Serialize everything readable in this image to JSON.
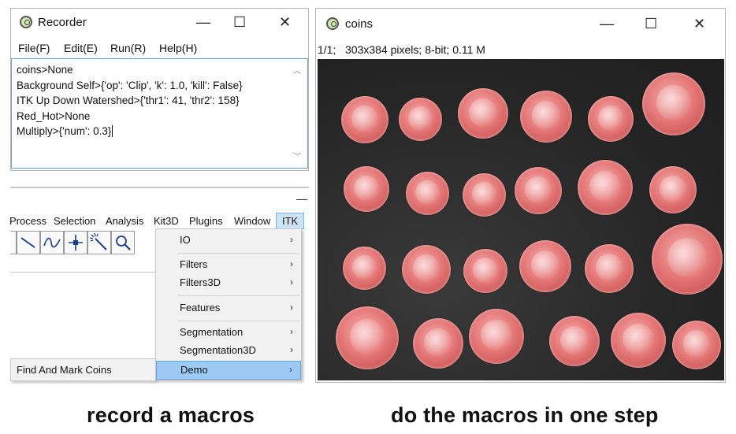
{
  "recorder": {
    "title": "Recorder",
    "menu": [
      "File(F)",
      "Edit(E)",
      "Run(R)",
      "Help(H)"
    ],
    "lines": [
      "coins>None",
      "Background Self>{'op': 'Clip', 'k': 1.0, 'kill': False}",
      "ITK Up Down Watershed>{'thr1': 41, 'thr2': 158}",
      "Red_Hot>None",
      "Multiply>{'num': 0.3}"
    ]
  },
  "imagej": {
    "minimize_glyph": "—",
    "menubar": [
      "Process",
      "Selection",
      "Analysis",
      "Kit3D",
      "Plugins",
      "Window",
      "ITK"
    ],
    "itk_menu": [
      {
        "label": "IO"
      },
      {
        "label": "Filters"
      },
      {
        "label": "Filters3D"
      },
      {
        "label": "Features"
      },
      {
        "label": "Segmentation"
      },
      {
        "label": "Segmentation3D"
      },
      {
        "label": "Demo"
      }
    ],
    "submenu_item": "Find And Mark Coins"
  },
  "image_window": {
    "title": "coins",
    "info": "1/1;   303x384 pixels; 8-bit; 0.11 M"
  },
  "window_controls": {
    "minimize": "—",
    "maximize": "☐",
    "close": "✕",
    "submenu_arrow": "›"
  },
  "captions": {
    "left": "record a macros",
    "right": "do the macros in one step"
  },
  "colors": {
    "accent_highlight": "#9ccaf5",
    "coin_tint": "#e57878",
    "image_background": "#2d2d2d"
  }
}
